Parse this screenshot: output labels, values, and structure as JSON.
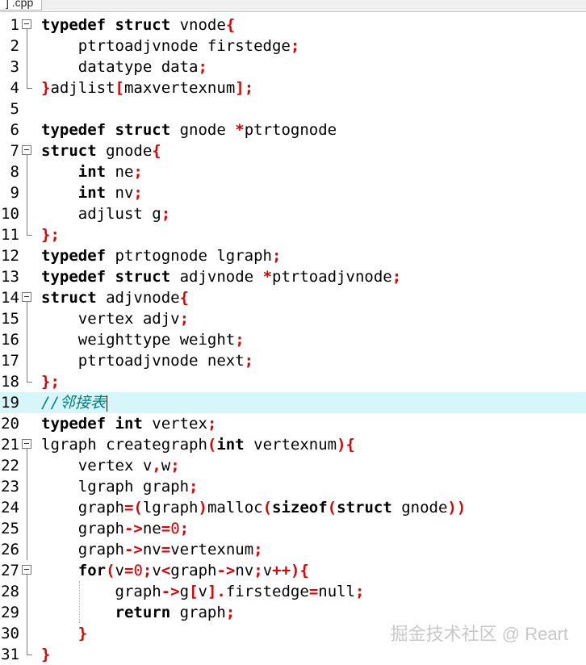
{
  "tab": {
    "label": "] .cpp"
  },
  "watermark": "掘金技术社区 @ Reart",
  "lines": [
    {
      "n": "1",
      "fold": "start",
      "tokens": [
        [
          "k",
          "typedef"
        ],
        [
          "t",
          " "
        ],
        [
          "k",
          "struct"
        ],
        [
          "t",
          " vnode"
        ],
        [
          "p",
          "{"
        ]
      ]
    },
    {
      "n": "2",
      "fold": "line",
      "tokens": [
        [
          "t",
          "    ptrtoadjvnode firstedge"
        ],
        [
          "p",
          ";"
        ]
      ]
    },
    {
      "n": "3",
      "fold": "line",
      "tokens": [
        [
          "t",
          "    datatype data"
        ],
        [
          "p",
          ";"
        ]
      ]
    },
    {
      "n": "4",
      "fold": "end",
      "tokens": [
        [
          "p",
          "}"
        ],
        [
          "t",
          "adjlist"
        ],
        [
          "p",
          "["
        ],
        [
          "t",
          "maxvertexnum"
        ],
        [
          "p",
          "];"
        ]
      ]
    },
    {
      "n": "5",
      "fold": "none",
      "tokens": []
    },
    {
      "n": "6",
      "fold": "none",
      "tokens": [
        [
          "k",
          "typedef"
        ],
        [
          "t",
          " "
        ],
        [
          "k",
          "struct"
        ],
        [
          "t",
          " gnode "
        ],
        [
          "p",
          "*"
        ],
        [
          "t",
          "ptrtognode"
        ]
      ]
    },
    {
      "n": "7",
      "fold": "start",
      "tokens": [
        [
          "k",
          "struct"
        ],
        [
          "t",
          " gnode"
        ],
        [
          "p",
          "{"
        ]
      ]
    },
    {
      "n": "8",
      "fold": "line",
      "tokens": [
        [
          "t",
          "    "
        ],
        [
          "k",
          "int"
        ],
        [
          "t",
          " ne"
        ],
        [
          "p",
          ";"
        ]
      ]
    },
    {
      "n": "9",
      "fold": "line",
      "tokens": [
        [
          "t",
          "    "
        ],
        [
          "k",
          "int"
        ],
        [
          "t",
          " nv"
        ],
        [
          "p",
          ";"
        ]
      ]
    },
    {
      "n": "10",
      "fold": "line",
      "tokens": [
        [
          "t",
          "    adjlust g"
        ],
        [
          "p",
          ";"
        ]
      ]
    },
    {
      "n": "11",
      "fold": "end",
      "tokens": [
        [
          "p",
          "};"
        ]
      ]
    },
    {
      "n": "12",
      "fold": "none",
      "tokens": [
        [
          "k",
          "typedef"
        ],
        [
          "t",
          " ptrtognode lgraph"
        ],
        [
          "p",
          ";"
        ]
      ]
    },
    {
      "n": "13",
      "fold": "none",
      "tokens": [
        [
          "k",
          "typedef"
        ],
        [
          "t",
          " "
        ],
        [
          "k",
          "struct"
        ],
        [
          "t",
          " adjvnode "
        ],
        [
          "p",
          "*"
        ],
        [
          "t",
          "ptrtoadjvnode"
        ],
        [
          "p",
          ";"
        ]
      ]
    },
    {
      "n": "14",
      "fold": "start",
      "tokens": [
        [
          "k",
          "struct"
        ],
        [
          "t",
          " adjvnode"
        ],
        [
          "p",
          "{"
        ]
      ]
    },
    {
      "n": "15",
      "fold": "line",
      "tokens": [
        [
          "t",
          "    vertex adjv"
        ],
        [
          "p",
          ";"
        ]
      ]
    },
    {
      "n": "16",
      "fold": "line",
      "tokens": [
        [
          "t",
          "    weighttype weight"
        ],
        [
          "p",
          ";"
        ]
      ]
    },
    {
      "n": "17",
      "fold": "line",
      "tokens": [
        [
          "t",
          "    ptrtoadjvnode next"
        ],
        [
          "p",
          ";"
        ]
      ]
    },
    {
      "n": "18",
      "fold": "end",
      "tokens": [
        [
          "p",
          "};"
        ]
      ]
    },
    {
      "n": "19",
      "fold": "none",
      "current": true,
      "tokens": [
        [
          "cm",
          "//邻接表"
        ]
      ]
    },
    {
      "n": "20",
      "fold": "none",
      "tokens": [
        [
          "k",
          "typedef"
        ],
        [
          "t",
          " "
        ],
        [
          "k",
          "int"
        ],
        [
          "t",
          " vertex"
        ],
        [
          "p",
          ";"
        ]
      ]
    },
    {
      "n": "21",
      "fold": "start",
      "tokens": [
        [
          "t",
          "lgraph creategraph"
        ],
        [
          "p",
          "("
        ],
        [
          "k",
          "int"
        ],
        [
          "t",
          " vertexnum"
        ],
        [
          "p",
          "){"
        ]
      ]
    },
    {
      "n": "22",
      "fold": "line",
      "tokens": [
        [
          "t",
          "    vertex v"
        ],
        [
          "p",
          ","
        ],
        [
          "t",
          "w"
        ],
        [
          "p",
          ";"
        ]
      ]
    },
    {
      "n": "23",
      "fold": "line",
      "tokens": [
        [
          "t",
          "    lgraph graph"
        ],
        [
          "p",
          ";"
        ]
      ]
    },
    {
      "n": "24",
      "fold": "line",
      "tokens": [
        [
          "t",
          "    graph"
        ],
        [
          "p",
          "=("
        ],
        [
          "t",
          "lgraph"
        ],
        [
          "p",
          ")"
        ],
        [
          "t",
          "malloc"
        ],
        [
          "p",
          "("
        ],
        [
          "k",
          "sizeof"
        ],
        [
          "p",
          "("
        ],
        [
          "k",
          "struct"
        ],
        [
          "t",
          " gnode"
        ],
        [
          "p",
          "))"
        ]
      ]
    },
    {
      "n": "25",
      "fold": "line",
      "tokens": [
        [
          "t",
          "    graph"
        ],
        [
          "p",
          "->"
        ],
        [
          "t",
          "ne"
        ],
        [
          "p",
          "="
        ],
        [
          "n",
          "0"
        ],
        [
          "p",
          ";"
        ]
      ]
    },
    {
      "n": "26",
      "fold": "line",
      "tokens": [
        [
          "t",
          "    graph"
        ],
        [
          "p",
          "->"
        ],
        [
          "t",
          "nv"
        ],
        [
          "p",
          "="
        ],
        [
          "t",
          "vertexnum"
        ],
        [
          "p",
          ";"
        ]
      ]
    },
    {
      "n": "27",
      "fold": "start",
      "tokens": [
        [
          "t",
          "    "
        ],
        [
          "k",
          "for"
        ],
        [
          "p",
          "("
        ],
        [
          "t",
          "v"
        ],
        [
          "p",
          "="
        ],
        [
          "n",
          "0"
        ],
        [
          "p",
          ";"
        ],
        [
          "t",
          "v"
        ],
        [
          "p",
          "<"
        ],
        [
          "t",
          "graph"
        ],
        [
          "p",
          "->"
        ],
        [
          "t",
          "nv"
        ],
        [
          "p",
          ";"
        ],
        [
          "t",
          "v"
        ],
        [
          "p",
          "++){"
        ]
      ]
    },
    {
      "n": "28",
      "fold": "line",
      "tokens": [
        [
          "t",
          "        graph"
        ],
        [
          "p",
          "->"
        ],
        [
          "t",
          "g"
        ],
        [
          "p",
          "["
        ],
        [
          "t",
          "v"
        ],
        [
          "p",
          "]."
        ],
        [
          "t",
          "firstedge"
        ],
        [
          "p",
          "="
        ],
        [
          "t",
          "null"
        ],
        [
          "p",
          ";"
        ]
      ]
    },
    {
      "n": "29",
      "fold": "line",
      "tokens": [
        [
          "t",
          "        "
        ],
        [
          "k",
          "return"
        ],
        [
          "t",
          " graph"
        ],
        [
          "p",
          ";"
        ]
      ]
    },
    {
      "n": "30",
      "fold": "line",
      "tokens": [
        [
          "t",
          "    "
        ],
        [
          "p",
          "}"
        ]
      ]
    },
    {
      "n": "31",
      "fold": "end",
      "tokens": [
        [
          "p",
          "}"
        ]
      ]
    }
  ]
}
